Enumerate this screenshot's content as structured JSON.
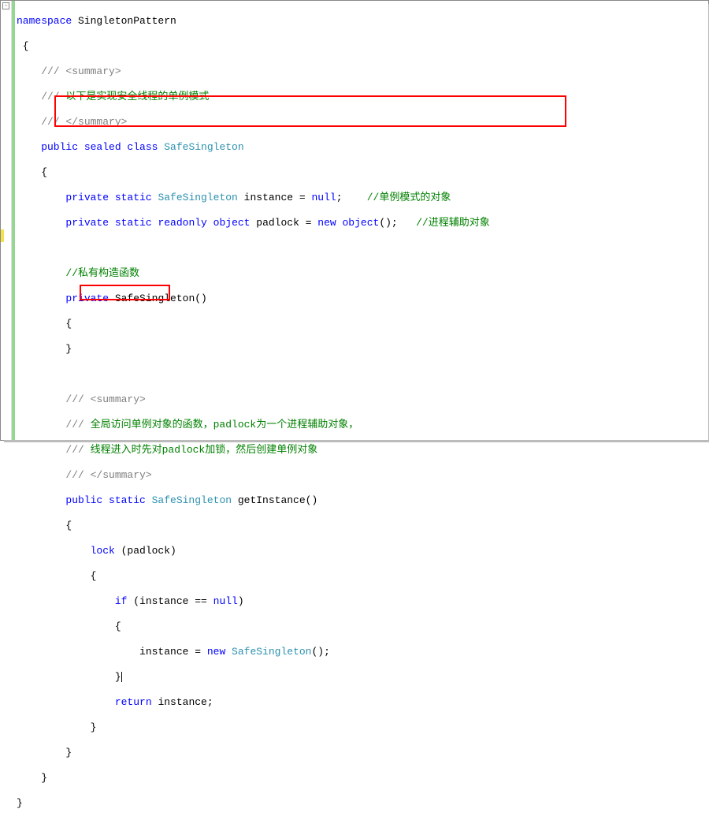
{
  "code": {
    "l1_namespace": "namespace",
    "l1_name": " SingletonPattern",
    "l2": " {",
    "l3a": "    /// ",
    "l3b": "<summary>",
    "l4a": "    /// ",
    "l4b": "以下是实现安全线程的单例模式",
    "l5a": "    /// ",
    "l5b": "</summary>",
    "l6a": "    public",
    "l6b": " sealed",
    "l6c": " class",
    "l6d": " SafeSingleton",
    "l7": "    {",
    "l8a": "        private",
    "l8b": " static",
    "l8c": " SafeSingleton",
    "l8d": " instance = ",
    "l8e": "null",
    "l8f": ";    ",
    "l8g": "//单例模式的对象",
    "l9a": "        private",
    "l9b": " static",
    "l9c": " readonly",
    "l9d": " object",
    "l9e": " padlock = ",
    "l9f": "new",
    "l9g": " object",
    "l9h": "();   ",
    "l9i": "//进程辅助对象",
    "l10": "",
    "l11a": "        ",
    "l11b": "//私有构造函数",
    "l12a": "        private",
    "l12b": " SafeSingleton()",
    "l13": "        {",
    "l14": "        }",
    "l15": "",
    "l16a": "        /// ",
    "l16b": "<summary>",
    "l17a": "        /// ",
    "l17b": "全局访问单例对象的函数，padlock为一个进程辅助对象，",
    "l18a": "        /// ",
    "l18b": "线程进入时先对padlock加锁，然后创建单例对象",
    "l19a": "        /// ",
    "l19b": "</summary>",
    "l20a": "        public",
    "l20b": " static",
    "l20c": " SafeSingleton",
    "l20d": " getInstance()",
    "l21": "        {",
    "l22a": "            lock",
    "l22b": " (padlock)",
    "l23": "            {",
    "l24a": "                if",
    "l24b": " (instance == ",
    "l24c": "null",
    "l24d": ")",
    "l25": "                {",
    "l26a": "                    instance = ",
    "l26b": "new",
    "l26c": " SafeSingleton",
    "l26d": "();",
    "l27": "                }",
    "l28a": "                return",
    "l28b": " instance;",
    "l29": "            }",
    "l30": "        }",
    "l31": "    }",
    "l32": "}"
  }
}
